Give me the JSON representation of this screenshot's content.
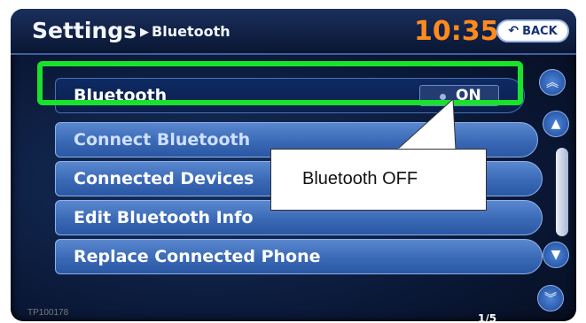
{
  "header": {
    "title": "Settings",
    "subtitle": "Bluetooth",
    "time": "10:35",
    "back_label": "BACK"
  },
  "menu": {
    "bluetooth": {
      "label": "Bluetooth",
      "state": "ON"
    },
    "items": [
      {
        "label": "Connect Bluetooth"
      },
      {
        "label": "Connected Devices"
      },
      {
        "label": "Edit Bluetooth Info"
      },
      {
        "label": "Replace Connected Phone"
      }
    ]
  },
  "callout": {
    "text": "Bluetooth OFF"
  },
  "page_indicator": "1/5",
  "caption": "TP100178",
  "colors": {
    "highlight": "#19e22a",
    "clock": "#ff8a1e"
  }
}
